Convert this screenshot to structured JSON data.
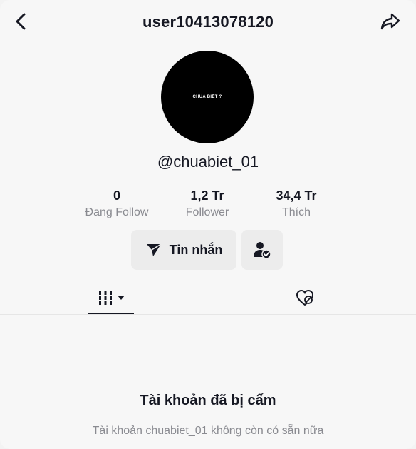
{
  "header": {
    "title": "user10413078120",
    "back_icon": "chevron-left-icon",
    "share_icon": "share-arrow-icon"
  },
  "profile": {
    "avatar_text": "CHUA BIẾT ?",
    "handle": "@chuabiet_01"
  },
  "stats": [
    {
      "value": "0",
      "label": "Đang Follow"
    },
    {
      "value": "1,2 Tr",
      "label": "Follower"
    },
    {
      "value": "34,4 Tr",
      "label": "Thích"
    }
  ],
  "actions": {
    "message_label": "Tin nhắn",
    "message_icon": "send-plane-icon",
    "add_friend_icon": "user-check-icon"
  },
  "tabs": {
    "videos_icon": "grid-bars-icon",
    "dropdown_icon": "caret-down-icon",
    "liked_icon": "heart-hidden-icon"
  },
  "banned": {
    "title": "Tài khoản đã bị cấm",
    "description": "Tài khoản chuabiet_01 không còn có sẵn nữa"
  },
  "colors": {
    "background": "#f7f7f7",
    "text_primary": "#161823",
    "text_secondary": "#8a8b91",
    "button_bg": "#ececec",
    "avatar_bg": "#000000"
  }
}
